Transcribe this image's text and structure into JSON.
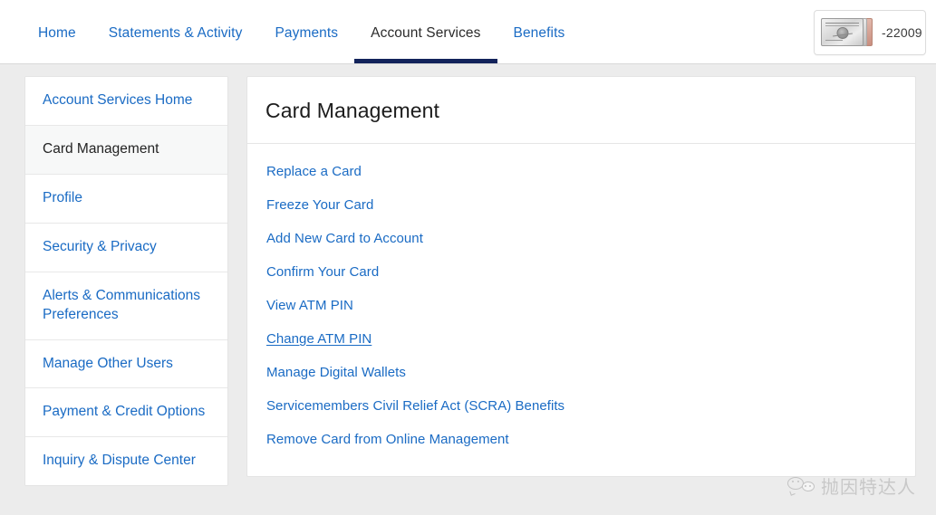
{
  "nav": {
    "tabs": [
      {
        "label": "Home",
        "active": false
      },
      {
        "label": "Statements & Activity",
        "active": false
      },
      {
        "label": "Payments",
        "active": false
      },
      {
        "label": "Account Services",
        "active": true
      },
      {
        "label": "Benefits",
        "active": false
      }
    ],
    "active_underline_color": "#13235b",
    "link_color": "#1a6bc4"
  },
  "account_selector": {
    "card_icon": "amex-platinum-card-icon",
    "digits": "-22009"
  },
  "sidebar": {
    "items": [
      {
        "label": "Account Services Home",
        "active": false
      },
      {
        "label": "Card Management",
        "active": true
      },
      {
        "label": "Profile",
        "active": false
      },
      {
        "label": "Security & Privacy",
        "active": false
      },
      {
        "label": "Alerts & Communications Preferences",
        "active": false
      },
      {
        "label": "Manage Other Users",
        "active": false
      },
      {
        "label": "Payment & Credit Options",
        "active": false
      },
      {
        "label": "Inquiry & Dispute Center",
        "active": false
      }
    ]
  },
  "main": {
    "title": "Card Management",
    "links": [
      {
        "label": "Replace a Card",
        "hovered": false
      },
      {
        "label": "Freeze Your Card",
        "hovered": false
      },
      {
        "label": "Add New Card to Account",
        "hovered": false
      },
      {
        "label": "Confirm Your Card",
        "hovered": false
      },
      {
        "label": "View ATM PIN",
        "hovered": false
      },
      {
        "label": "Change ATM PIN",
        "hovered": true
      },
      {
        "label": "Manage Digital Wallets",
        "hovered": false
      },
      {
        "label": "Servicemembers Civil Relief Act (SCRA) Benefits",
        "hovered": false
      },
      {
        "label": "Remove Card from Online Management",
        "hovered": false
      }
    ]
  },
  "watermark": {
    "icon": "wechat-icon",
    "text": "抛因特达人"
  }
}
